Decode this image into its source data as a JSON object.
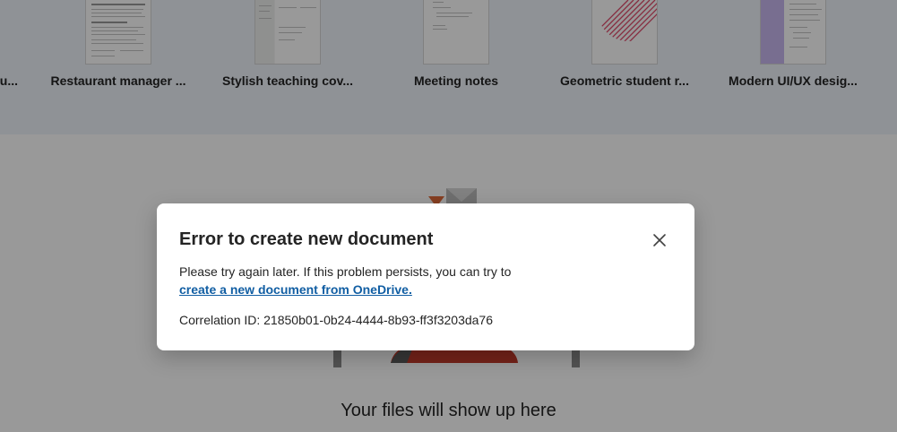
{
  "templates": [
    {
      "name": "u..."
    },
    {
      "name": "Restaurant manager ..."
    },
    {
      "name": "Stylish teaching cov..."
    },
    {
      "name": "Meeting notes"
    },
    {
      "name": "Geometric student r..."
    },
    {
      "name": "Modern UI/UX desig..."
    }
  ],
  "empty_state": {
    "message": "Your files will show up here"
  },
  "dialog": {
    "title": "Error to create new document",
    "body_text": "Please try again later. If this problem persists, you can try to",
    "link_text": "create a new document from OneDrive.",
    "correlation": "Correlation ID: 21850b01-0b24-4444-8b93-ff3f3203da76",
    "close_icon": "close-icon"
  },
  "colors": {
    "link": "#115ea3",
    "overlay": "rgba(0,0,0,0.40)"
  }
}
